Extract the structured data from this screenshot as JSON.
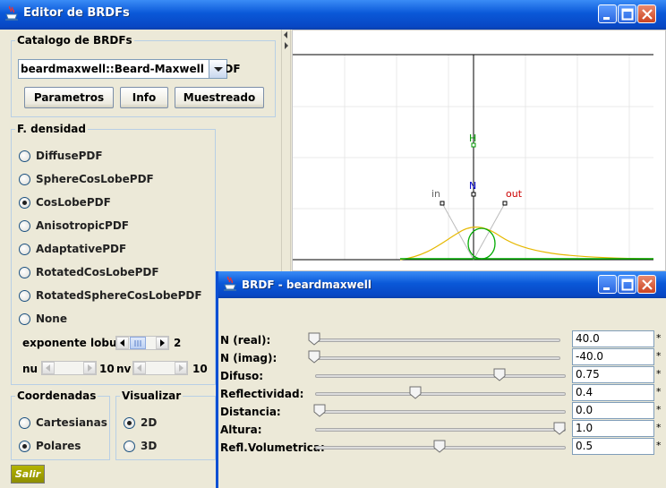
{
  "main_window": {
    "title": "Editor de BRDFs"
  },
  "catalog": {
    "legend": "Catalogo de BRDFs",
    "selected": "beardmaxwell::Beard-Maxwell BRDF",
    "buttons": {
      "parametros": "Parametros",
      "info": "Info",
      "muestreado": "Muestreado"
    }
  },
  "densidad": {
    "legend": "F. densidad",
    "options": [
      {
        "label": "DiffusePDF",
        "checked": false
      },
      {
        "label": "SphereCosLobePDF",
        "checked": false
      },
      {
        "label": "CosLobePDF",
        "checked": true
      },
      {
        "label": "AnisotropicPDF",
        "checked": false
      },
      {
        "label": "AdaptativePDF",
        "checked": false
      },
      {
        "label": "RotatedCosLobePDF",
        "checked": false
      },
      {
        "label": "RotatedSphereCosLobePDF",
        "checked": false
      },
      {
        "label": "None",
        "checked": false
      }
    ],
    "exponente_label": "exponente lobulo",
    "exponente_value": "2",
    "nu_label": "nu",
    "nu_value": "10",
    "nv_label": "nv",
    "nv_value": "10"
  },
  "coordenadas": {
    "legend": "Coordenadas",
    "options": [
      {
        "label": "Cartesianas",
        "checked": false
      },
      {
        "label": "Polares",
        "checked": true
      }
    ]
  },
  "visualizar": {
    "legend": "Visualizar",
    "options": [
      {
        "label": "2D",
        "checked": true
      },
      {
        "label": "3D",
        "checked": false
      }
    ]
  },
  "salir_label": "Salir",
  "plot": {
    "labels": {
      "h": "H",
      "n": "N",
      "in": "in",
      "out": "out"
    },
    "colors": {
      "h": "#009900",
      "n": "#0000cc",
      "in": "#666666",
      "out": "#cc0000",
      "lobe": "#e6b800",
      "curve": "#00aa00"
    }
  },
  "brdf_window": {
    "title": "BRDF - beardmaxwell",
    "params": [
      {
        "label": "N (real):",
        "value": "40.0",
        "position": 0.0
      },
      {
        "label": "N (imag):",
        "value": "-40.0",
        "position": 0.0
      },
      {
        "label": "Difuso:",
        "value": "0.75",
        "position": 0.75
      },
      {
        "label": "Reflectividad:",
        "value": "0.4",
        "position": 0.4
      },
      {
        "label": "Distancia:",
        "value": "0.0",
        "position": 0.0
      },
      {
        "label": "Altura:",
        "value": "1.0",
        "position": 1.0
      },
      {
        "label": "Refl.Volumetrica:",
        "value": "0.5",
        "position": 0.5
      }
    ],
    "mark": "*"
  }
}
